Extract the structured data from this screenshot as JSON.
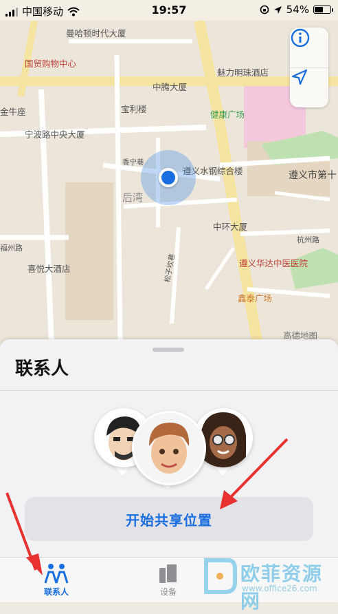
{
  "status_bar": {
    "carrier": "中国移动",
    "time": "19:57",
    "battery": "54%"
  },
  "map": {
    "pois": [
      {
        "label": "曼哈顿时代大厦"
      },
      {
        "label": "国贸购物中心"
      },
      {
        "label": "魅力明珠酒店"
      },
      {
        "label": "中腾大厦"
      },
      {
        "label": "宝利楼"
      },
      {
        "label": "金牛座"
      },
      {
        "label": "健康广场"
      },
      {
        "label": "宁波路中央大厦"
      },
      {
        "label": "香宁巷"
      },
      {
        "label": "遵义水钢综合楼"
      },
      {
        "label": "遵义市第十"
      },
      {
        "label": "后湾"
      },
      {
        "label": "中环大厦"
      },
      {
        "label": "杭州路"
      },
      {
        "label": "福州路"
      },
      {
        "label": "喜悦大酒店"
      },
      {
        "label": "松子坎巷"
      },
      {
        "label": "遵义华达中医医院"
      },
      {
        "label": "鑫泰广场"
      },
      {
        "label": "高德地图"
      }
    ],
    "info_button": "info-icon",
    "locate_button": "location-arrow-icon"
  },
  "sheet": {
    "title": "联系人",
    "share_button_label": "开始共享位置"
  },
  "tabs": [
    {
      "label": "联系人",
      "icon": "people-icon",
      "active": true
    },
    {
      "label": "设备",
      "icon": "devices-icon",
      "active": false
    }
  ],
  "watermark": {
    "text": "欧菲资源网",
    "url": "www.office26.com"
  },
  "colors": {
    "accent": "#1a6fe0",
    "annotation_arrow": "#e8322f"
  }
}
